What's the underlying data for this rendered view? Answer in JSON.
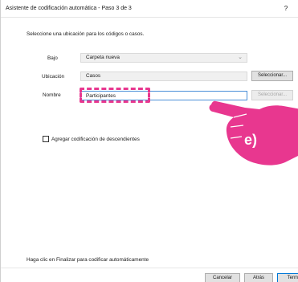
{
  "window": {
    "title": "Asistente de codificación automática - Paso 3 de 3",
    "help_label": "?"
  },
  "instruction": "Seleccione una ubicación para los códigos o casos.",
  "form": {
    "bajo_label": "Bajo",
    "bajo_value": "Carpeta nueva",
    "ubicacion_label": "Ubicación",
    "ubicacion_value": "Casos",
    "nombre_label": "Nombre",
    "nombre_value": "Participantes",
    "select_button_label": "Seleccionar...",
    "select_button_disabled_label": "Seleccionar..."
  },
  "checkbox": {
    "label": "Agregar codificación de descendientes",
    "checked": false
  },
  "annotation": {
    "label": "e)",
    "color": "#e8378f"
  },
  "footer": {
    "hint": "Haga clic en Finalizar para codificar automáticamente",
    "cancel_label": "Cancelar",
    "back_label": "Atrás",
    "finish_label": "Termi"
  }
}
